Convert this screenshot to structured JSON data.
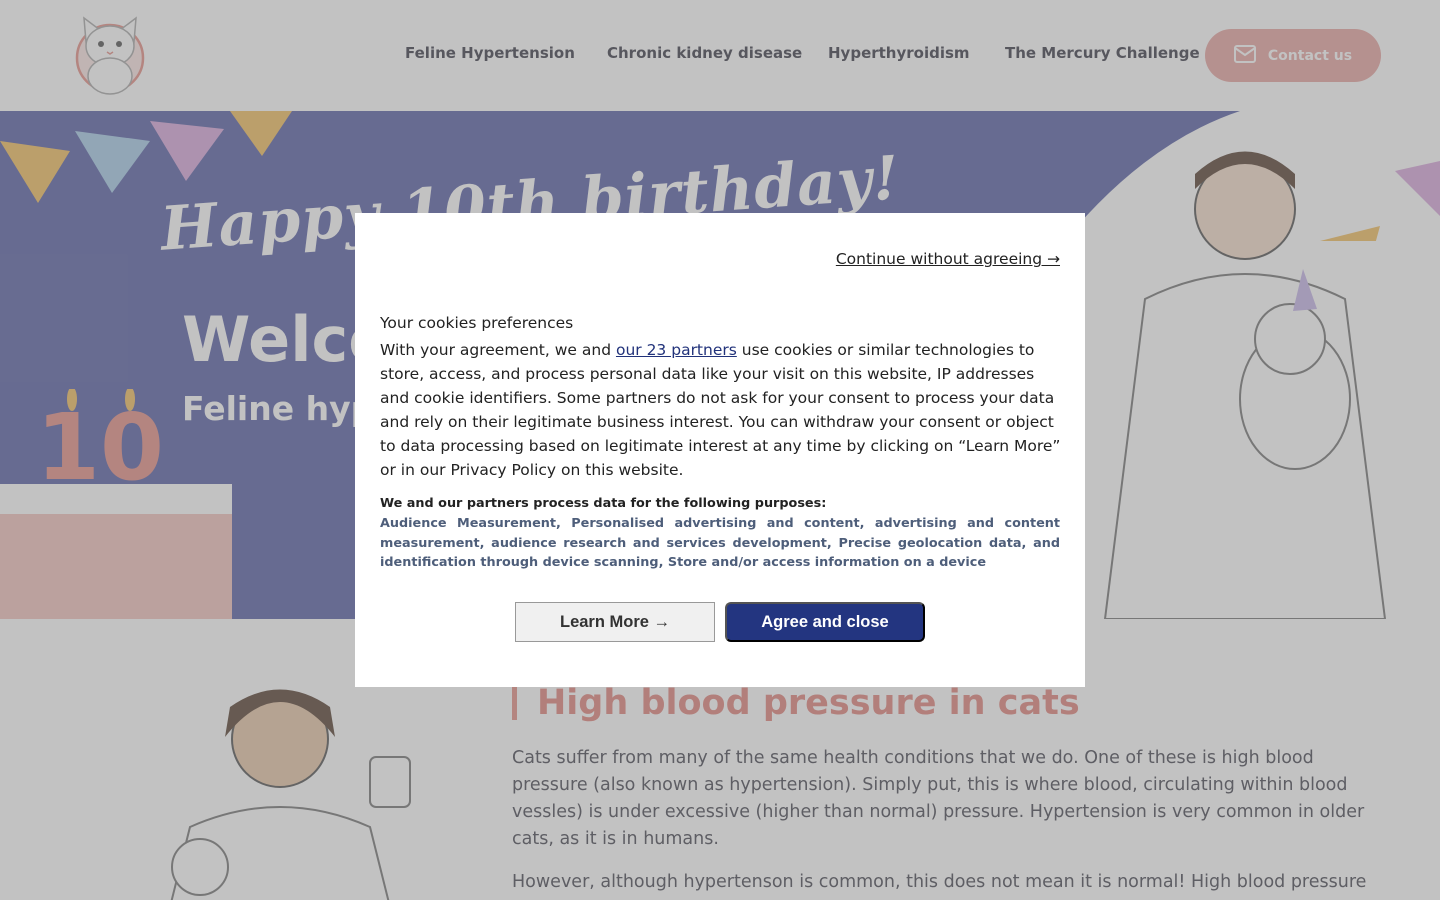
{
  "header": {
    "logo_icon": "cat-logo-icon",
    "nav": [
      {
        "label": "Feline Hypertension"
      },
      {
        "label": "Chronic kidney disease"
      },
      {
        "label": "Hyperthyroidism"
      },
      {
        "label": "The Mercury Challenge"
      }
    ],
    "contact_label": "Contact us",
    "contact_icon": "envelope-icon"
  },
  "hero": {
    "happy_birthday": "Happy 10th birthday!",
    "welcome": "Welcome",
    "subtitle": "Feline hypertension"
  },
  "content": {
    "title": "High blood pressure in cats",
    "para1": "Cats suffer from many of the same health conditions that we do. One of these is high blood pressure (also known as hypertension). Simply put, this is where blood, circulating within blood vessles) is under excessive (higher than normal) pressure. Hypertension is very common in older cats, as it is in humans.",
    "para2": "However, although hypertenson is common, this does not mean it is normal! High blood pressure is"
  },
  "cookie": {
    "continue_label": "Continue without agreeing →",
    "title": "Your cookies preferences",
    "text_before": "With your agreement, we and ",
    "partners_link": "our 23 partners",
    "text_after": " use cookies or similar technologies to store, access, and process personal data like your visit on this website, IP addresses and cookie identifiers. Some partners do not ask for your consent to process your data and rely on their legitimate business interest. You can withdraw your consent or object to data processing based on legitimate interest at any time by clicking on “Learn More” or in our Privacy Policy on this website.",
    "purposes_title": "We and our partners process data for the following purposes:",
    "purposes_list": "Audience Measurement, Personalised advertising and content, advertising and content measurement, audience research and services development, Precise geolocation data, and identification through device scanning, Store and/or access information on a device",
    "learn_more_label": "Learn More →",
    "agree_label": "Agree and close"
  },
  "colors": {
    "brand_pink": "#e59088",
    "hero_blue": "#5a62a6",
    "agree_navy": "#233580"
  }
}
